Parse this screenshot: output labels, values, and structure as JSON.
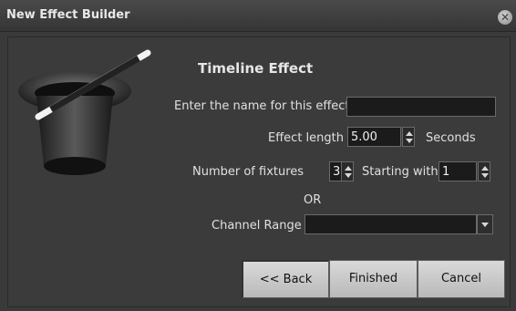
{
  "window": {
    "title": "New Effect Builder"
  },
  "dialog": {
    "heading": "Timeline Effect",
    "name_label": "Enter the name for this effect",
    "name_value": "",
    "length_label": "Effect length",
    "length_value": "5.00",
    "length_unit": "Seconds",
    "fixtures_label": "Number of fixtures",
    "fixtures_value": "3",
    "start_label": "Starting with",
    "start_value": "1",
    "or_text": "OR",
    "range_label": "Channel Range",
    "range_value": ""
  },
  "buttons": {
    "back": "<< Back",
    "finished": "Finished",
    "cancel": "Cancel"
  },
  "icons": [
    "magic-hat-icon",
    "close-icon",
    "spin-up-icon",
    "spin-down-icon",
    "dropdown-arrow-icon"
  ]
}
